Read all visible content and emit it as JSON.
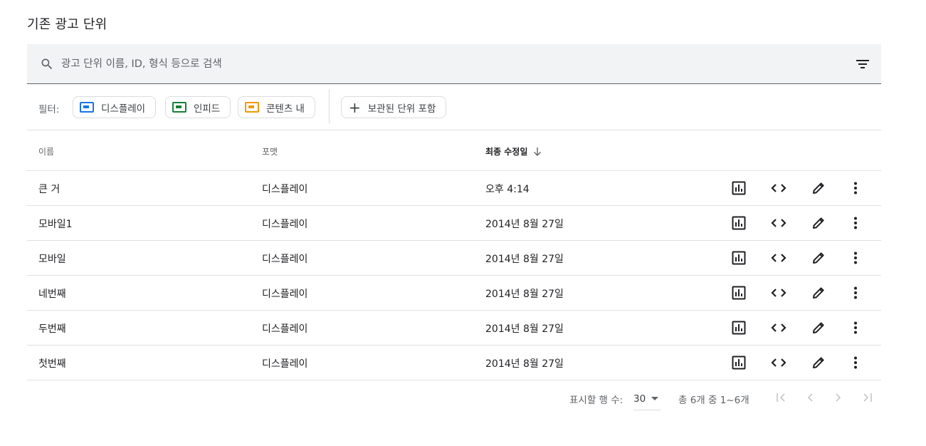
{
  "page": {
    "title": "기존 광고 단위"
  },
  "search": {
    "placeholder": "광고 단위 이름, ID, 형식 등으로 검색"
  },
  "filters": {
    "label": "필터:",
    "chips": [
      {
        "label": "디스플레이",
        "color": "#1a73e8"
      },
      {
        "label": "인피드",
        "color": "#188038"
      },
      {
        "label": "콘텐츠 내",
        "color": "#f29900"
      }
    ],
    "archived_label": "보관된 단위 포함"
  },
  "table": {
    "columns": {
      "name": "이름",
      "format": "포맷",
      "modified": "최종 수정일"
    },
    "rows": [
      {
        "name": "큰 거",
        "format": "디스플레이",
        "modified": "오후 4:14"
      },
      {
        "name": "모바일1",
        "format": "디스플레이",
        "modified": "2014년 8월 27일"
      },
      {
        "name": "모바일",
        "format": "디스플레이",
        "modified": "2014년 8월 27일"
      },
      {
        "name": "네번째",
        "format": "디스플레이",
        "modified": "2014년 8월 27일"
      },
      {
        "name": "두번째",
        "format": "디스플레이",
        "modified": "2014년 8월 27일"
      },
      {
        "name": "첫번째",
        "format": "디스플레이",
        "modified": "2014년 8월 27일"
      }
    ],
    "row_actions": [
      "report-icon",
      "code-icon",
      "edit-icon",
      "more-vert-icon"
    ]
  },
  "pagination": {
    "rows_label": "표시할 행 수:",
    "rows_value": "30",
    "range": "총 6개 중 1~6개"
  }
}
